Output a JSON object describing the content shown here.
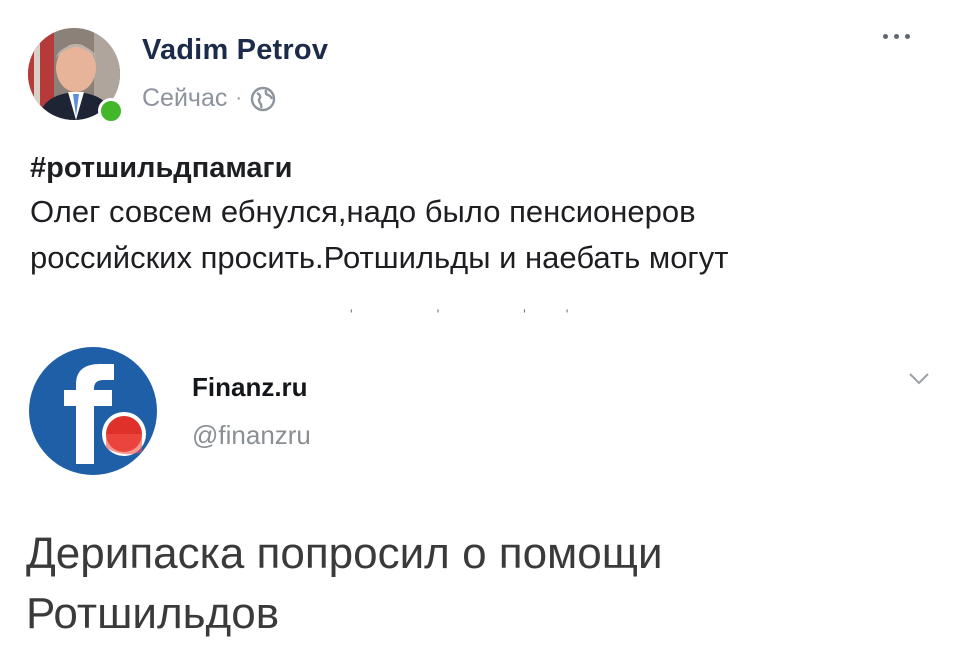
{
  "post": {
    "author_name": "Vadim Petrov",
    "timestamp": "Сейчас",
    "separator": "·",
    "privacy_icon": "globe-icon",
    "more_icon": "more-dots-icon",
    "online_color": "#42b72a",
    "hashtag": "#ротшильдпамаги",
    "text": "Олег совсем ебнулся,надо было пенсионеров\nроссийских просить.Ротшильды и наебать могут"
  },
  "embed": {
    "logo_icon": "finanz-logo-icon",
    "logo_color": "#1e5fa8",
    "logo_dot_color": "#e0302a",
    "name": "Finanz.ru",
    "handle": "@finanzru",
    "chevron_icon": "chevron-down-icon",
    "text": "Дерипаска попросил о помощи\nРотшильдов"
  }
}
